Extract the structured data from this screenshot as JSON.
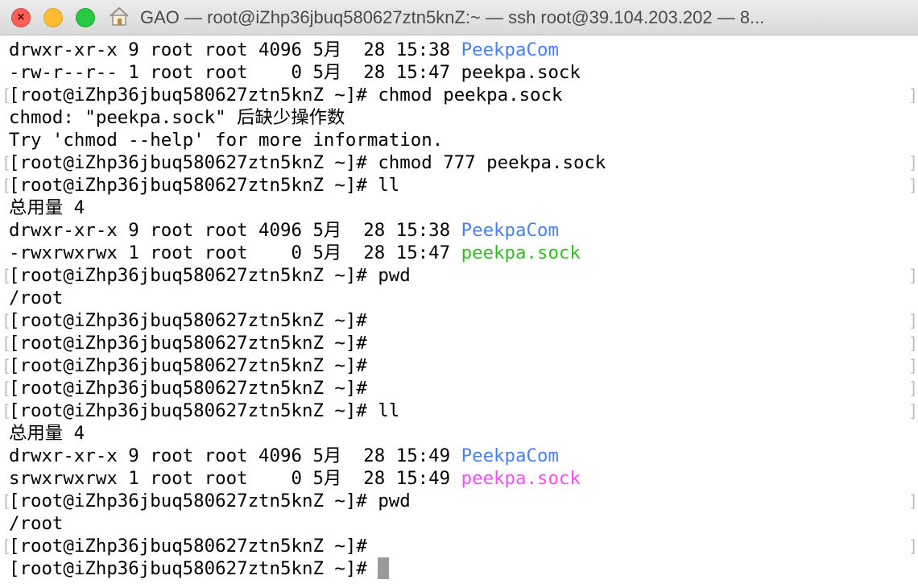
{
  "window": {
    "title": "GAO — root@iZhp36jbuq580627ztn5knZ:~ — ssh root@39.104.203.202 — 8...",
    "title_icon": "home-icon",
    "traffic_lights": {
      "close": "#fe5f57",
      "minimize": "#febc2e",
      "zoom": "#28c840"
    }
  },
  "colors": {
    "directory": "#4a7ff0",
    "executable": "#34bc26",
    "socket": "#f24ff5",
    "text": "#000000",
    "background": "#ffffff"
  },
  "terminal": {
    "lines": [
      {
        "text": "drwxr-xr-x 9 root root 4096 5月  28 15:38 ",
        "name": "PeekpaCom"
      },
      {
        "text": "-rw-r--r-- 1 root root    0 5月  28 15:47 peekpa.sock"
      },
      {
        "text": "[root@iZhp36jbuq580627ztn5knZ ~]# chmod peekpa.sock"
      },
      {
        "text": "chmod: \"peekpa.sock\" 后缺少操作数"
      },
      {
        "text": "Try 'chmod --help' for more information."
      },
      {
        "text": "[root@iZhp36jbuq580627ztn5knZ ~]# chmod 777 peekpa.sock"
      },
      {
        "text": "[root@iZhp36jbuq580627ztn5knZ ~]# ll"
      },
      {
        "text": "总用量 4"
      },
      {
        "text": "drwxr-xr-x 9 root root 4096 5月  28 15:38 ",
        "name": "PeekpaCom"
      },
      {
        "text": "-rwxrwxrwx 1 root root    0 5月  28 15:47 ",
        "name": "peekpa.sock"
      },
      {
        "text": "[root@iZhp36jbuq580627ztn5knZ ~]# pwd"
      },
      {
        "text": "/root"
      },
      {
        "text": "[root@iZhp36jbuq580627ztn5knZ ~]#"
      },
      {
        "text": "[root@iZhp36jbuq580627ztn5knZ ~]#"
      },
      {
        "text": "[root@iZhp36jbuq580627ztn5knZ ~]#"
      },
      {
        "text": "[root@iZhp36jbuq580627ztn5knZ ~]#"
      },
      {
        "text": "[root@iZhp36jbuq580627ztn5knZ ~]# ll"
      },
      {
        "text": "总用量 4"
      },
      {
        "text": "drwxr-xr-x 9 root root 4096 5月  28 15:49 ",
        "name": "PeekpaCom"
      },
      {
        "text": "srwxrwxrwx 1 root root    0 5月  28 15:49 ",
        "name": "peekpa.sock"
      },
      {
        "text": "[root@iZhp36jbuq580627ztn5knZ ~]# pwd"
      },
      {
        "text": "/root"
      },
      {
        "text": "[root@iZhp36jbuq580627ztn5knZ ~]#"
      },
      {
        "text": "[root@iZhp36jbuq580627ztn5knZ ~]# "
      }
    ]
  }
}
